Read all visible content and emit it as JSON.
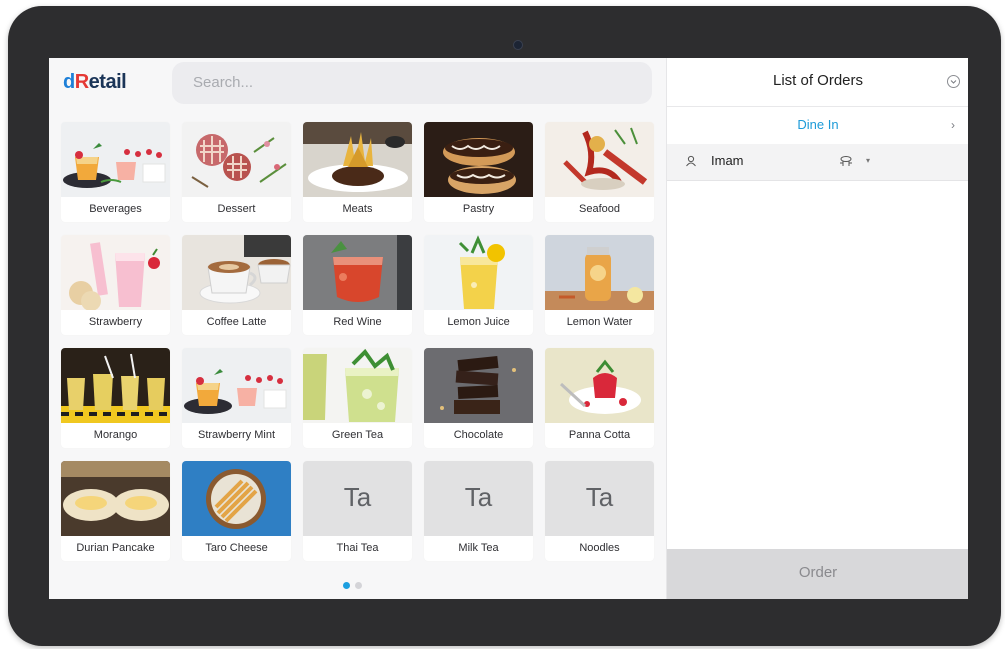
{
  "app": {
    "logo_part1": "d",
    "logo_part2": "R",
    "logo_part3": "etail"
  },
  "search": {
    "placeholder": "Search..."
  },
  "products": [
    {
      "label": "Beverages",
      "image": "beverages"
    },
    {
      "label": "Dessert",
      "image": "dessert"
    },
    {
      "label": "Meats",
      "image": "meats"
    },
    {
      "label": "Pastry",
      "image": "pastry"
    },
    {
      "label": "Seafood",
      "image": "seafood"
    },
    {
      "label": "Strawberry",
      "image": "strawberry"
    },
    {
      "label": "Coffee Latte",
      "image": "coffee-latte"
    },
    {
      "label": "Red Wine",
      "image": "red-wine"
    },
    {
      "label": "Lemon Juice",
      "image": "lemon-juice"
    },
    {
      "label": "Lemon Water",
      "image": "lemon-water"
    },
    {
      "label": "Morango",
      "image": "morango"
    },
    {
      "label": "Strawberry Mint",
      "image": "strawberry-mint"
    },
    {
      "label": "Green Tea",
      "image": "green-tea"
    },
    {
      "label": "Chocolate",
      "image": "chocolate"
    },
    {
      "label": "Panna Cotta",
      "image": "panna-cotta"
    },
    {
      "label": "Durian Pancake",
      "image": "durian-pancake"
    },
    {
      "label": "Taro Cheese",
      "image": "taro-cheese"
    },
    {
      "label": "Thai Tea",
      "placeholder": "Ta"
    },
    {
      "label": "Milk Tea",
      "placeholder": "Ta"
    },
    {
      "label": "Noodles",
      "placeholder": "Ta"
    }
  ],
  "pagination": {
    "total": 2,
    "current": 1
  },
  "orders": {
    "title": "List of Orders",
    "order_type": "Dine In",
    "customer": "Imam",
    "order_button": "Order"
  },
  "colors": {
    "accent": "#1d9bd8",
    "logo_blue": "#1f80d8",
    "logo_red": "#e53935",
    "logo_navy": "#1b3558"
  },
  "icons": {
    "collapse": "chevron-down-circle-icon",
    "dine_in_arrow": "chevron-right-icon",
    "customer": "user-icon",
    "table": "table-icon"
  }
}
